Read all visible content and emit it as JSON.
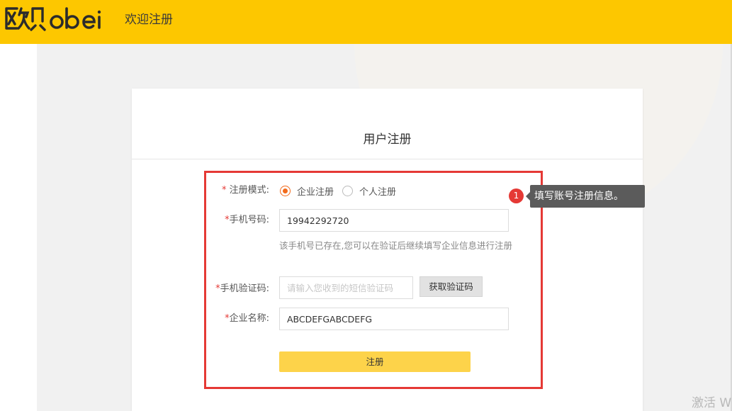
{
  "header": {
    "logo_text": "欧贝 obei",
    "welcome": "欢迎注册",
    "brand_color": "#fdc700"
  },
  "card": {
    "title": "用户注册"
  },
  "form": {
    "mode": {
      "label": "注册模式:",
      "options": [
        {
          "label": "企业注册",
          "selected": true
        },
        {
          "label": "个人注册",
          "selected": false
        }
      ]
    },
    "phone": {
      "label": "手机号码:",
      "value": "19942292720",
      "hint": "该手机号已存在,您可以在验证后继续填写企业信息进行注册"
    },
    "sms_code": {
      "label": "手机验证码:",
      "placeholder": "请输入您收到的短信验证码",
      "button_label": "获取验证码"
    },
    "company": {
      "label": "企业名称:",
      "value": "ABCDEFGABCDEFG"
    },
    "required_mark": "*",
    "submit_label": "注册"
  },
  "guide": {
    "step": "1",
    "tooltip": "填写账号注册信息。",
    "highlight_color": "#e53935"
  },
  "watermark": "激活 W"
}
